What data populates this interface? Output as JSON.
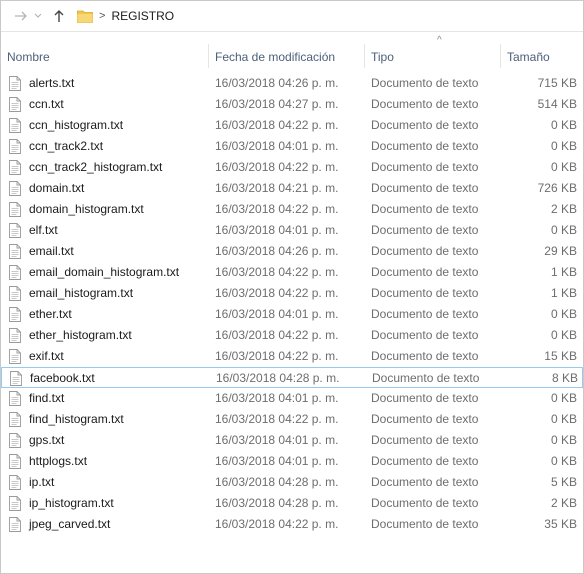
{
  "address": {
    "current_folder": "REGISTRO",
    "separator": ">"
  },
  "columns": {
    "name": "Nombre",
    "date": "Fecha de modificación",
    "type": "Tipo",
    "size": "Tamaño",
    "sort_indicator": "^"
  },
  "files": [
    {
      "name": "alerts.txt",
      "date": "16/03/2018 04:26 p. m.",
      "type": "Documento de texto",
      "size": "715 KB"
    },
    {
      "name": "ccn.txt",
      "date": "16/03/2018 04:27 p. m.",
      "type": "Documento de texto",
      "size": "514 KB"
    },
    {
      "name": "ccn_histogram.txt",
      "date": "16/03/2018 04:22 p. m.",
      "type": "Documento de texto",
      "size": "0 KB"
    },
    {
      "name": "ccn_track2.txt",
      "date": "16/03/2018 04:01 p. m.",
      "type": "Documento de texto",
      "size": "0 KB"
    },
    {
      "name": "ccn_track2_histogram.txt",
      "date": "16/03/2018 04:22 p. m.",
      "type": "Documento de texto",
      "size": "0 KB"
    },
    {
      "name": "domain.txt",
      "date": "16/03/2018 04:21 p. m.",
      "type": "Documento de texto",
      "size": "726 KB"
    },
    {
      "name": "domain_histogram.txt",
      "date": "16/03/2018 04:22 p. m.",
      "type": "Documento de texto",
      "size": "2 KB"
    },
    {
      "name": "elf.txt",
      "date": "16/03/2018 04:01 p. m.",
      "type": "Documento de texto",
      "size": "0 KB"
    },
    {
      "name": "email.txt",
      "date": "16/03/2018 04:26 p. m.",
      "type": "Documento de texto",
      "size": "29 KB"
    },
    {
      "name": "email_domain_histogram.txt",
      "date": "16/03/2018 04:22 p. m.",
      "type": "Documento de texto",
      "size": "1 KB"
    },
    {
      "name": "email_histogram.txt",
      "date": "16/03/2018 04:22 p. m.",
      "type": "Documento de texto",
      "size": "1 KB"
    },
    {
      "name": "ether.txt",
      "date": "16/03/2018 04:01 p. m.",
      "type": "Documento de texto",
      "size": "0 KB"
    },
    {
      "name": "ether_histogram.txt",
      "date": "16/03/2018 04:22 p. m.",
      "type": "Documento de texto",
      "size": "0 KB"
    },
    {
      "name": "exif.txt",
      "date": "16/03/2018 04:22 p. m.",
      "type": "Documento de texto",
      "size": "15 KB"
    },
    {
      "name": "facebook.txt",
      "date": "16/03/2018 04:28 p. m.",
      "type": "Documento de texto",
      "size": "8 KB",
      "selected": true
    },
    {
      "name": "find.txt",
      "date": "16/03/2018 04:01 p. m.",
      "type": "Documento de texto",
      "size": "0 KB"
    },
    {
      "name": "find_histogram.txt",
      "date": "16/03/2018 04:22 p. m.",
      "type": "Documento de texto",
      "size": "0 KB"
    },
    {
      "name": "gps.txt",
      "date": "16/03/2018 04:01 p. m.",
      "type": "Documento de texto",
      "size": "0 KB"
    },
    {
      "name": "httplogs.txt",
      "date": "16/03/2018 04:01 p. m.",
      "type": "Documento de texto",
      "size": "0 KB"
    },
    {
      "name": "ip.txt",
      "date": "16/03/2018 04:28 p. m.",
      "type": "Documento de texto",
      "size": "5 KB"
    },
    {
      "name": "ip_histogram.txt",
      "date": "16/03/2018 04:28 p. m.",
      "type": "Documento de texto",
      "size": "2 KB"
    },
    {
      "name": "jpeg_carved.txt",
      "date": "16/03/2018 04:22 p. m.",
      "type": "Documento de texto",
      "size": "35 KB"
    }
  ],
  "icons": {
    "back": "arrow-right-icon",
    "recent": "chevron-down-icon",
    "up": "arrow-up-icon",
    "folder": "folder-icon",
    "file": "text-file-icon"
  },
  "colors": {
    "header_text": "#4c607a",
    "selection_border": "#99c9ef",
    "folder": "#f3c64a"
  }
}
